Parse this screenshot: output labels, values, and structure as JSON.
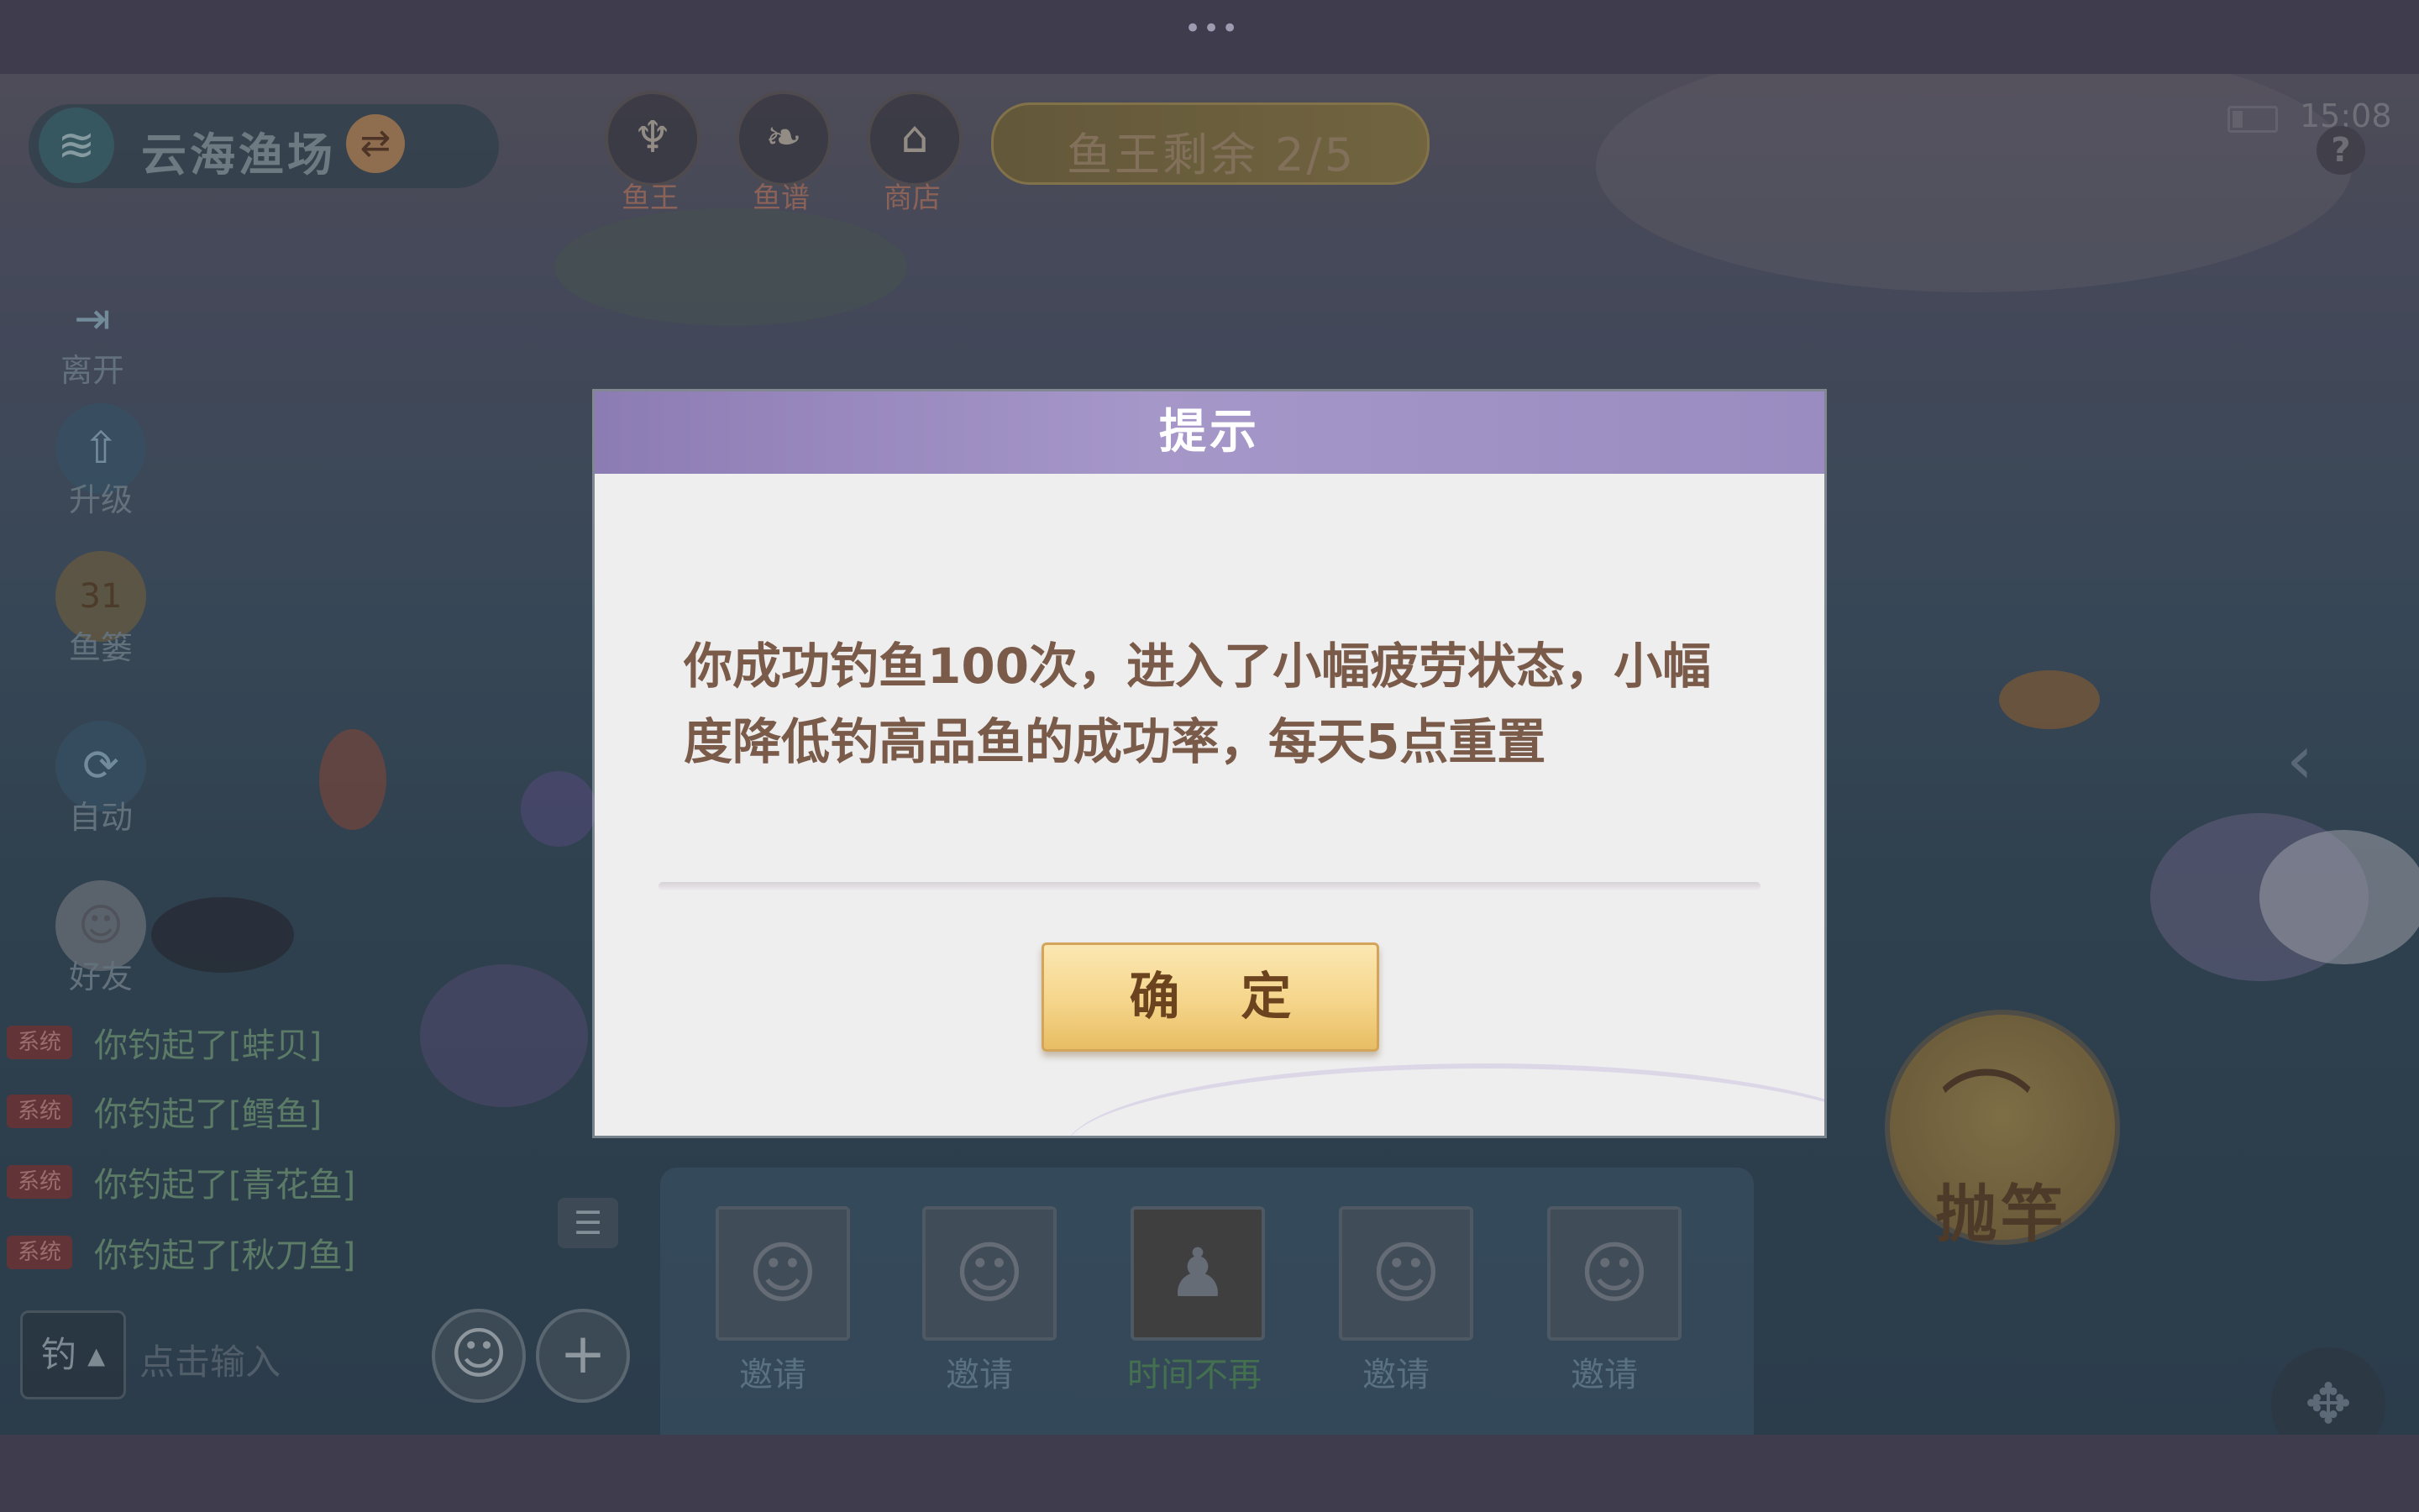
{
  "system_bar": {
    "dots": "•••"
  },
  "game": {
    "fishery": {
      "name": "云海渔场"
    },
    "top_buttons": [
      {
        "label": "鱼王",
        "icon": "fish-king-icon"
      },
      {
        "label": "鱼谱",
        "icon": "fish-book-icon"
      },
      {
        "label": "商店",
        "icon": "shop-icon"
      }
    ],
    "fish_king_remaining": "鱼王剩余 2/5",
    "clock": "15:08",
    "help": "?",
    "side_menu": [
      {
        "label": "离开",
        "icon": "exit-icon"
      },
      {
        "label": "升级",
        "icon": "upgrade-icon"
      },
      {
        "label": "鱼篓",
        "icon": "fish-basket-icon",
        "badge": "31"
      },
      {
        "label": "自动",
        "icon": "auto-icon"
      },
      {
        "label": "好友",
        "icon": "friends-icon"
      }
    ],
    "chat": {
      "messages": [
        {
          "tag": "系统",
          "text": "你钓起了[蚌贝]"
        },
        {
          "tag": "系统",
          "text": "你钓起了[鳕鱼]"
        },
        {
          "tag": "系统",
          "text": "你钓起了[青花鱼]"
        },
        {
          "tag": "系统",
          "text": "你钓起了[秋刀鱼]"
        }
      ],
      "mode_label": "钓",
      "input_placeholder": "点击输入"
    },
    "invite_slots": [
      {
        "label": "邀请"
      },
      {
        "label": "邀请"
      },
      {
        "label": "时间不再"
      },
      {
        "label": "邀请"
      },
      {
        "label": "邀请"
      }
    ],
    "cast_button": {
      "label": "抛竿"
    }
  },
  "dialog": {
    "title": "提示",
    "message": "你成功钓鱼100次，进入了小幅疲劳状态，小幅度降低钓高品鱼的成功率，每天5点重置",
    "confirm": "确 定"
  },
  "colors": {
    "dialog_header": "#9a8cc0",
    "confirm_button": "#f5d58a",
    "message_text": "#7a5b4a"
  }
}
